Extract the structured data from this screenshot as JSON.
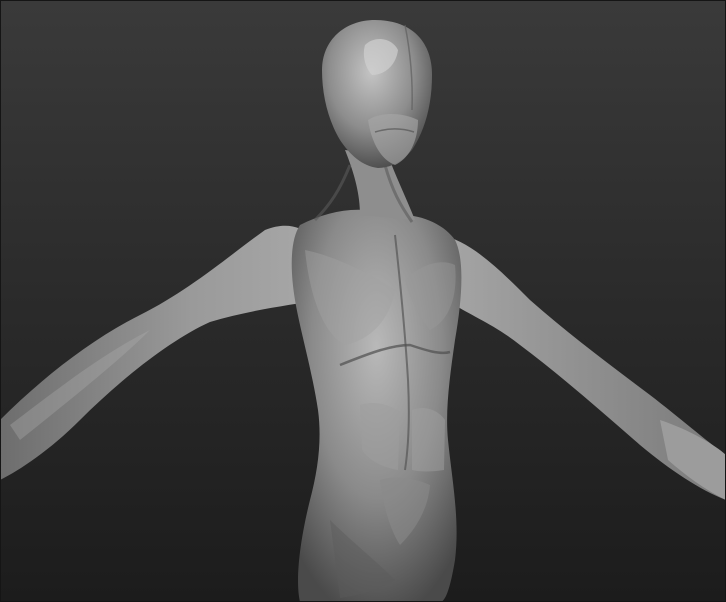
{
  "viewport": {
    "background_top": "#3a3a3a",
    "background_bottom": "#1c1c1c",
    "material_color": "#8f8f8f"
  },
  "model": {
    "subject": "humanoid-alien-torso-sculpt",
    "icon": "matcap-grey-material"
  }
}
